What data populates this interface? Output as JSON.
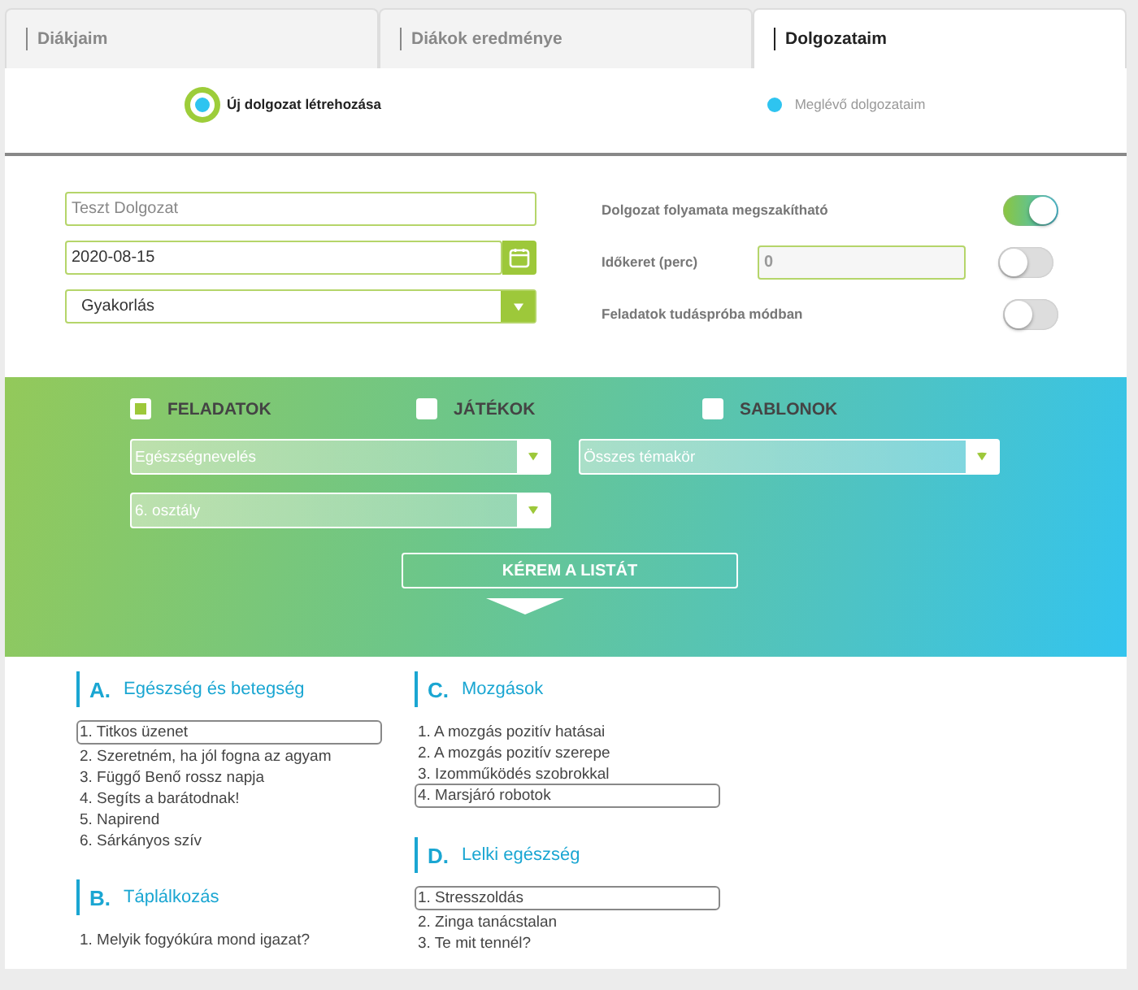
{
  "tabs": [
    {
      "label": "Diákjaim",
      "selected": false
    },
    {
      "label": "Diákok eredménye",
      "selected": false
    },
    {
      "label": "Dolgozataim",
      "selected": true
    }
  ],
  "steps": [
    {
      "label": "Új dolgozat létrehozása",
      "selected": true
    },
    {
      "label": "Meglévő dolgozataim",
      "selected": false
    }
  ],
  "form": {
    "title_field": {
      "placeholder": "Teszt Dolgozat"
    },
    "date_field": {
      "value": "2020-08-15"
    },
    "type_select": {
      "value": "Gyakorlás"
    },
    "options": [
      {
        "label": "Dolgozat folyamata megszakítható",
        "on": true
      },
      {
        "label": "Időkeret (perc)",
        "on": false,
        "field": "0"
      },
      {
        "label": "Feladatok tudáspróba módban",
        "on": false
      }
    ]
  },
  "filter": {
    "categories": [
      {
        "label": "FELADATOK",
        "checked": true
      },
      {
        "label": "JÁTÉKOK",
        "checked": false
      },
      {
        "label": "SABLONOK",
        "checked": false
      }
    ],
    "selects": [
      {
        "value": "Egészségnevelés"
      },
      {
        "value": "Összes témakör"
      },
      {
        "value": "6. osztály"
      }
    ],
    "button": "KÉREM A LISTÁT"
  },
  "lessons": {
    "columns": [
      [
        {
          "letter": "A.",
          "title": "Egészség és betegség",
          "items": [
            {
              "label": "1. Titkos üzenet",
              "selected": true
            },
            {
              "label": "2. Szeretném, ha jól fogna az agyam",
              "selected": false
            },
            {
              "label": "3. Függő Benő rossz napja",
              "selected": false
            },
            {
              "label": "4. Segíts a barátodnak!",
              "selected": false
            },
            {
              "label": "5. Napirend",
              "selected": false
            },
            {
              "label": "6. Sárkányos szív",
              "selected": false
            }
          ]
        },
        {
          "letter": "B.",
          "title": "Táplálkozás",
          "items": [
            {
              "label": "1. Melyik fogyókúra mond igazat?",
              "selected": false
            }
          ]
        }
      ],
      [
        {
          "letter": "C.",
          "title": "Mozgások",
          "items": [
            {
              "label": "1. A mozgás pozitív hatásai",
              "selected": false
            },
            {
              "label": "2. A mozgás pozitív szerepe",
              "selected": false
            },
            {
              "label": "3. Izomműködés szobrokkal",
              "selected": false
            },
            {
              "label": "4. Marsjáró robotok",
              "selected": true
            }
          ]
        },
        {
          "letter": "D.",
          "title": "Lelki egészség",
          "items": [
            {
              "label": "1. Stresszoldás",
              "selected": true
            },
            {
              "label": "2. Zinga tanácstalan",
              "selected": false
            },
            {
              "label": "3. Te mit tennél?",
              "selected": false
            }
          ]
        }
      ]
    ]
  }
}
